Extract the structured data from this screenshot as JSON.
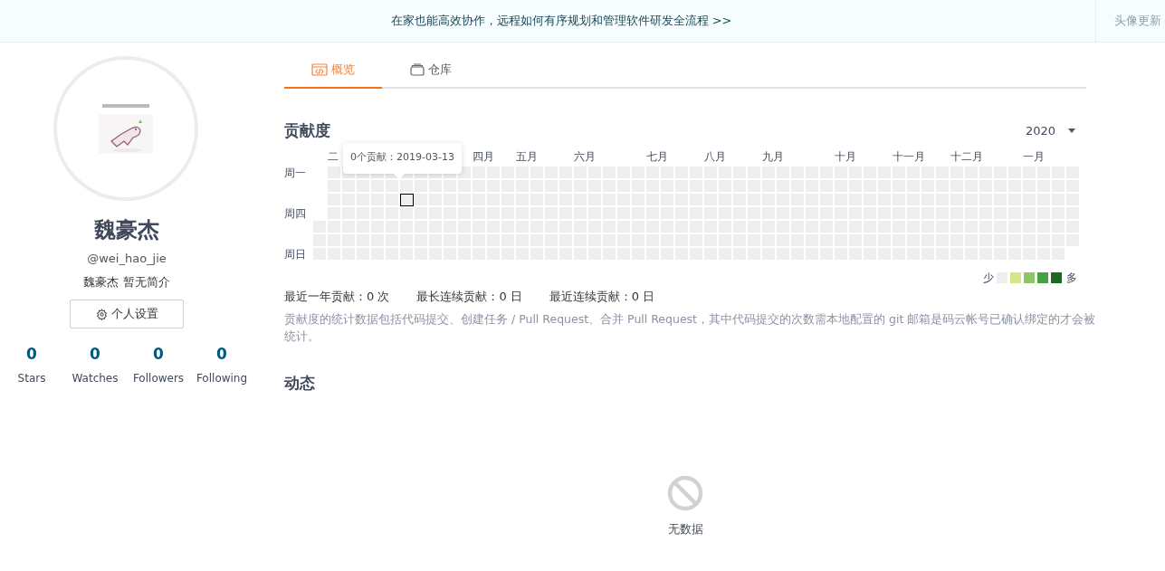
{
  "banner": {
    "text": "在家也能高效协作，远程如何有序规划和管理软件研发全流程 >>",
    "side_button": "头像更新"
  },
  "profile": {
    "name": "魏豪杰",
    "handle": "@wei_hao_jie",
    "bio": "魏豪杰 暂无简介",
    "settings_button": "个人设置",
    "stats": [
      {
        "value": "0",
        "label": "Stars"
      },
      {
        "value": "0",
        "label": "Watches"
      },
      {
        "value": "0",
        "label": "Followers"
      },
      {
        "value": "0",
        "label": "Following"
      }
    ]
  },
  "tabs": [
    {
      "label": "概览",
      "selected": true
    },
    {
      "label": "仓库",
      "selected": false
    }
  ],
  "contribution": {
    "title": "贡献度",
    "year": "2020",
    "months": [
      "二",
      "四月",
      "五月",
      "六月",
      "七月",
      "八月",
      "九月",
      "十月",
      "十一月",
      "十二月",
      "一月"
    ],
    "weekdays": [
      "周一",
      "周四",
      "周日"
    ],
    "tooltip": "0个贡献：2019-03-13",
    "legend": {
      "less": "少",
      "more": "多",
      "colors": [
        {
          "color": "#eeeeee"
        },
        {
          "color": "#d6e685"
        },
        {
          "color": "#8cc665"
        },
        {
          "color": "#44a340"
        },
        {
          "color": "#1e6823"
        }
      ]
    },
    "stats": [
      "最近一年贡献：0 次",
      "最长连续贡献：0 日",
      "最近连续贡献：0 日"
    ],
    "note": "贡献度的统计数据包括代码提交、创建任务 / Pull Request、合并 Pull Request，其中代码提交的次数需本地配置的 git 邮箱是码云帐号已确认绑定的才会被统计。"
  },
  "activity": {
    "title": "动态",
    "empty_text": "无数据"
  }
}
